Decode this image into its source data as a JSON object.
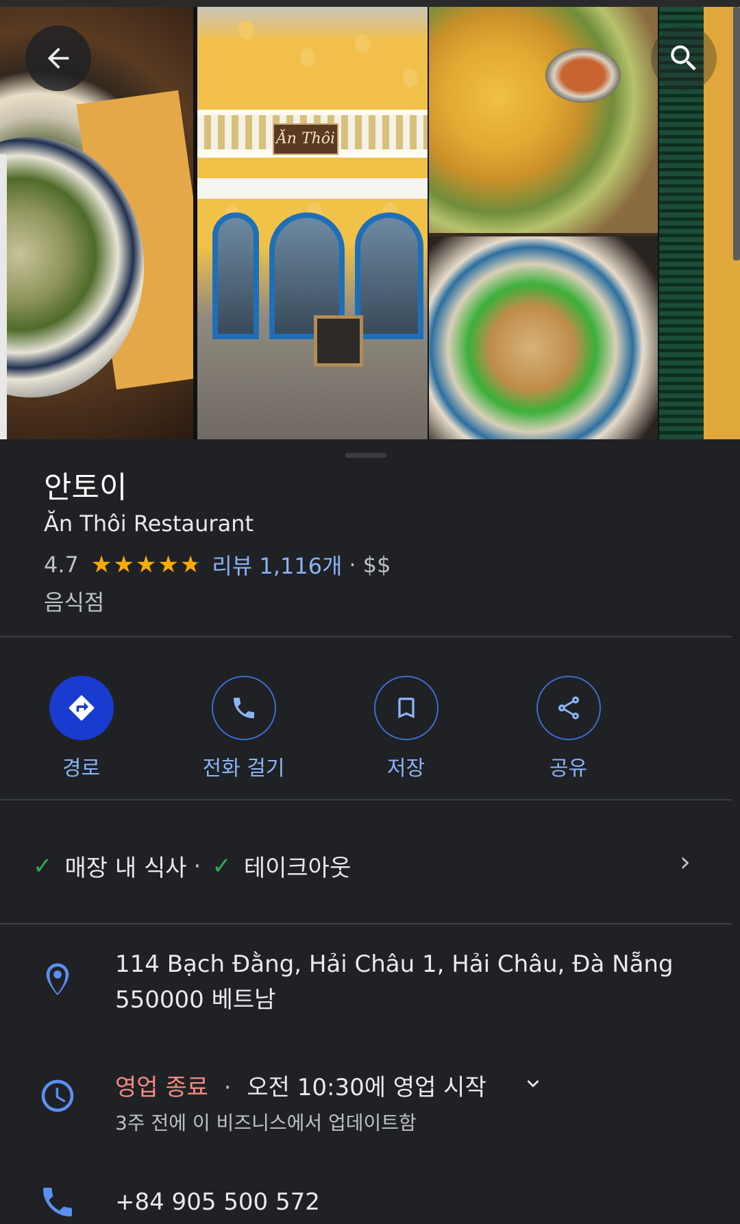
{
  "photos": {
    "sign_text": "Ăn Thôi"
  },
  "header": {
    "back_icon": "arrow-left-icon",
    "search_icon": "search-icon"
  },
  "place": {
    "name": "안토이",
    "subtitle": "Ăn Thôi Restaurant",
    "rating": "4.7",
    "rating_stars": 4.7,
    "stars_glyph": "★★★★★",
    "reviews": "리뷰 1,116개",
    "dot": "·",
    "price": "$$",
    "category": "음식점"
  },
  "actions": [
    {
      "label": "경로",
      "icon": "directions-icon"
    },
    {
      "label": "전화 걸기",
      "icon": "phone-icon"
    },
    {
      "label": "저장",
      "icon": "bookmark-icon"
    },
    {
      "label": "공유",
      "icon": "share-icon"
    }
  ],
  "services": {
    "dine_in": "매장 내 식사",
    "separator": "·",
    "takeout": "테이크아웃"
  },
  "address": {
    "line1": "114 Bạch Đằng, Hải Châu 1, Hải Châu, Đà Nẵng",
    "line2": "550000 베트남"
  },
  "hours": {
    "status": "영업 종료",
    "separator": "·",
    "next": "오전 10:30에 영업 시작",
    "updated": "3주 전에 이 비즈니스에서 업데이트함"
  },
  "phone": {
    "number": "+84 905 500 572"
  },
  "colors": {
    "background": "#202124",
    "accent_blue": "#8ab4f8",
    "primary_button": "#1a3bd0",
    "star": "#f9ab00",
    "closed_red": "#f28b82",
    "check_green": "#34a853"
  }
}
